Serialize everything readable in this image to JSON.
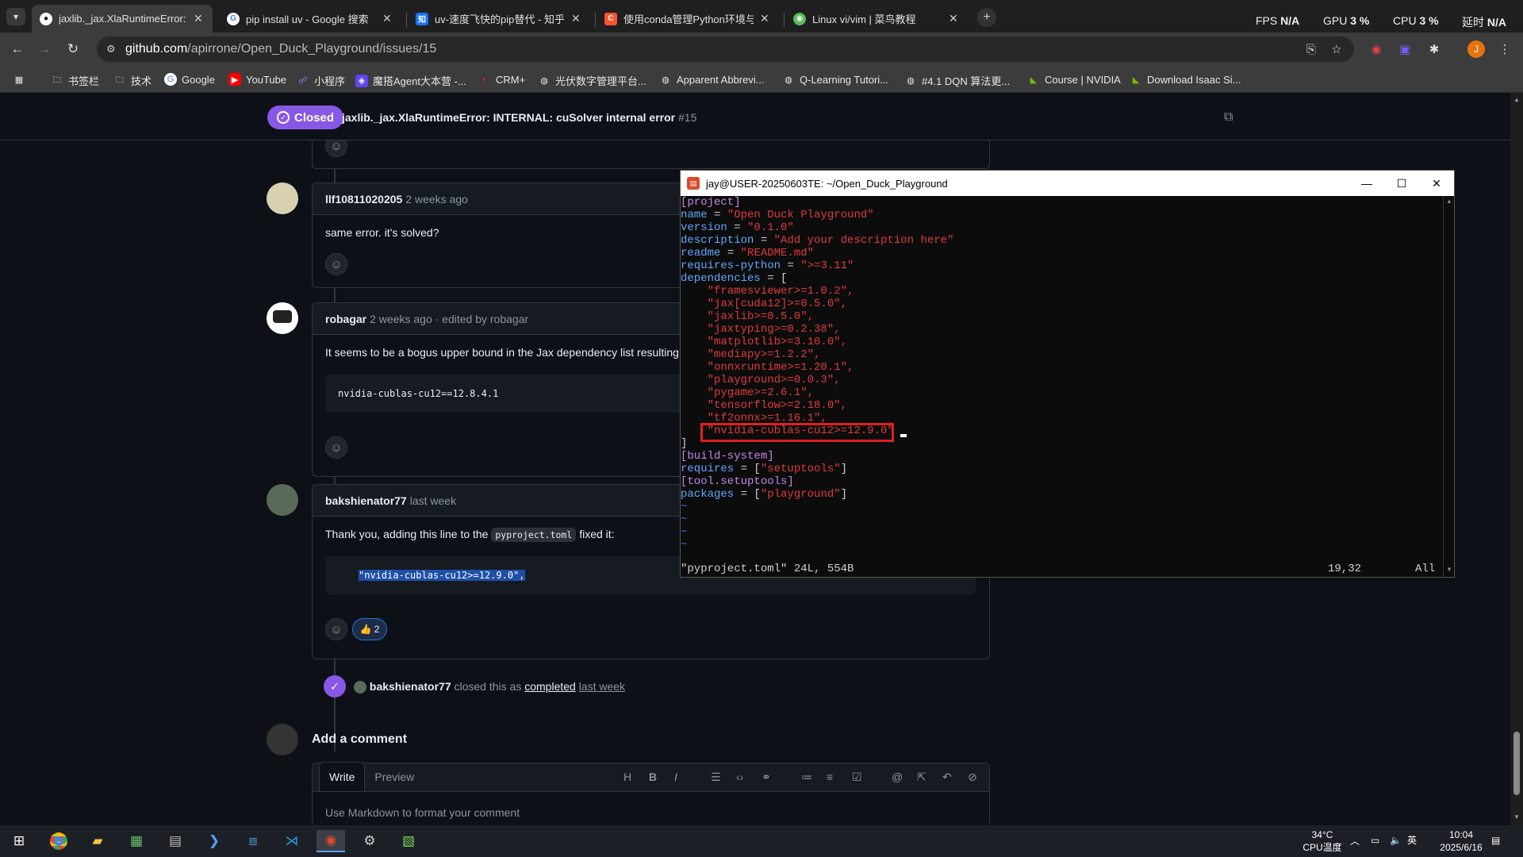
{
  "browser": {
    "tabs": [
      {
        "label": "jaxlib._jax.XlaRuntimeError: I",
        "icon": "github-icon",
        "active": true
      },
      {
        "label": "pip install uv - Google 搜索",
        "icon": "google-icon"
      },
      {
        "label": "uv-速度飞快的pip替代 - 知乎",
        "icon": "zhihu-icon"
      },
      {
        "label": "使用conda管理Python环境与包",
        "icon": "csdn-icon"
      },
      {
        "label": "Linux vi/vim | 菜鸟教程",
        "icon": "runoob-icon"
      }
    ],
    "perf": {
      "fps_label": "FPS",
      "fps_value": "N/A",
      "gpu_label": "GPU",
      "gpu_value": "3 %",
      "cpu_label": "CPU",
      "cpu_value": "3 %",
      "latency_label": "延时",
      "latency_value": "N/A"
    },
    "address": {
      "host": "github.com",
      "path": "/apirrone/Open_Duck_Playground/issues/15"
    },
    "profile_initial": "J",
    "bookmarks": [
      "书签栏",
      "技术",
      "Google",
      "YouTube",
      "小程序",
      "魔搭Agent大本营 -...",
      "CRM+",
      "光伏数字管理平台...",
      "Apparent Abbrevi...",
      "Q-Learning Tutori...",
      "#4.1 DQN 算法更...",
      "Course | NVIDIA",
      "Download Isaac Si..."
    ]
  },
  "issue": {
    "status": "Closed",
    "title": "jaxlib._jax.XlaRuntimeError: INTERNAL: cuSolver internal error",
    "number": "#15"
  },
  "comments": [
    {
      "author": "llf10811020205",
      "time": "2 weeks ago",
      "body": "same error. it's solved?"
    },
    {
      "author": "robagar",
      "time": "2 weeks ago · edited by robagar",
      "body": "It seems to be a bogus upper bound in the Jax dependency list resulting",
      "code": "nvidia-cublas-cu12==12.8.4.1"
    },
    {
      "author": "bakshienator77",
      "time": "last week",
      "body_pre": "Thank you, adding this line to the",
      "body_code": "pyproject.toml",
      "body_post": "fixed it:",
      "code": "\"nvidia-cublas-cu12>=12.9.0\",",
      "reaction": "👍",
      "reaction_count": "2"
    }
  ],
  "event": {
    "author": "bakshienator77",
    "text": "closed this as",
    "link": "completed",
    "time": "last week"
  },
  "add_comment": {
    "heading": "Add a comment",
    "tab_write": "Write",
    "tab_preview": "Preview",
    "placeholder": "Use Markdown to format your comment",
    "tools": [
      "H",
      "B",
      "I"
    ]
  },
  "terminal": {
    "title": "jay@USER-20250603TE: ~/Open_Duck_Playground",
    "lines": [
      {
        "k": "[project]",
        "t": "section"
      },
      {
        "key": "name",
        "val": "\"Open Duck Playground\""
      },
      {
        "key": "version",
        "val": "\"0.1.0\""
      },
      {
        "key": "description",
        "val": "\"Add your description here\""
      },
      {
        "key": "readme",
        "val": "\"README.md\""
      },
      {
        "key": "requires-python",
        "val": "\">=3.11\""
      },
      {
        "key": "dependencies",
        "raw": " = ["
      },
      {
        "dep": "\"framesviewer>=1.0.2\","
      },
      {
        "dep": "\"jax[cuda12]>=0.5.0\","
      },
      {
        "dep": "\"jaxlib>=0.5.0\","
      },
      {
        "dep": "\"jaxtyping>=0.2.38\","
      },
      {
        "dep": "\"matplotlib>=3.10.0\","
      },
      {
        "dep": "\"mediapy>=1.2.2\","
      },
      {
        "dep": "\"onnxruntime>=1.20.1\","
      },
      {
        "dep": "\"playground>=0.0.3\","
      },
      {
        "dep": "\"pygame>=2.6.1\","
      },
      {
        "dep": "\"tensorflow>=2.18.0\","
      },
      {
        "dep": "\"tf2onnx>=1.16.1\","
      },
      {
        "dep": "\"nvidia-cublas-cu12>=12.9.0\""
      },
      {
        "raw": "]"
      },
      {
        "k": "[build-system]",
        "t": "section"
      },
      {
        "key": "requires",
        "raw": " = [",
        "val": "\"setuptools\"",
        "tail": "]"
      },
      {
        "k": "[tool.setuptools]",
        "t": "section"
      },
      {
        "key": "packages",
        "raw": " = [",
        "val": "\"playground\"",
        "tail": "]"
      },
      {
        "tilde": "~"
      },
      {
        "tilde": "~"
      },
      {
        "tilde": "~"
      },
      {
        "tilde": "~"
      }
    ],
    "status_file": "\"pyproject.toml\" 24L, 554B",
    "status_pos": "19,32",
    "status_all": "All"
  },
  "taskbar": {
    "temp": "34°C",
    "temp_label": "CPU温度",
    "ime": "英",
    "time": "10:04",
    "date": "2025/6/16"
  },
  "colors": {
    "accent_purple": "#8957e5",
    "highlight_red": "#e02020",
    "selection_blue": "#1f4fa8"
  }
}
